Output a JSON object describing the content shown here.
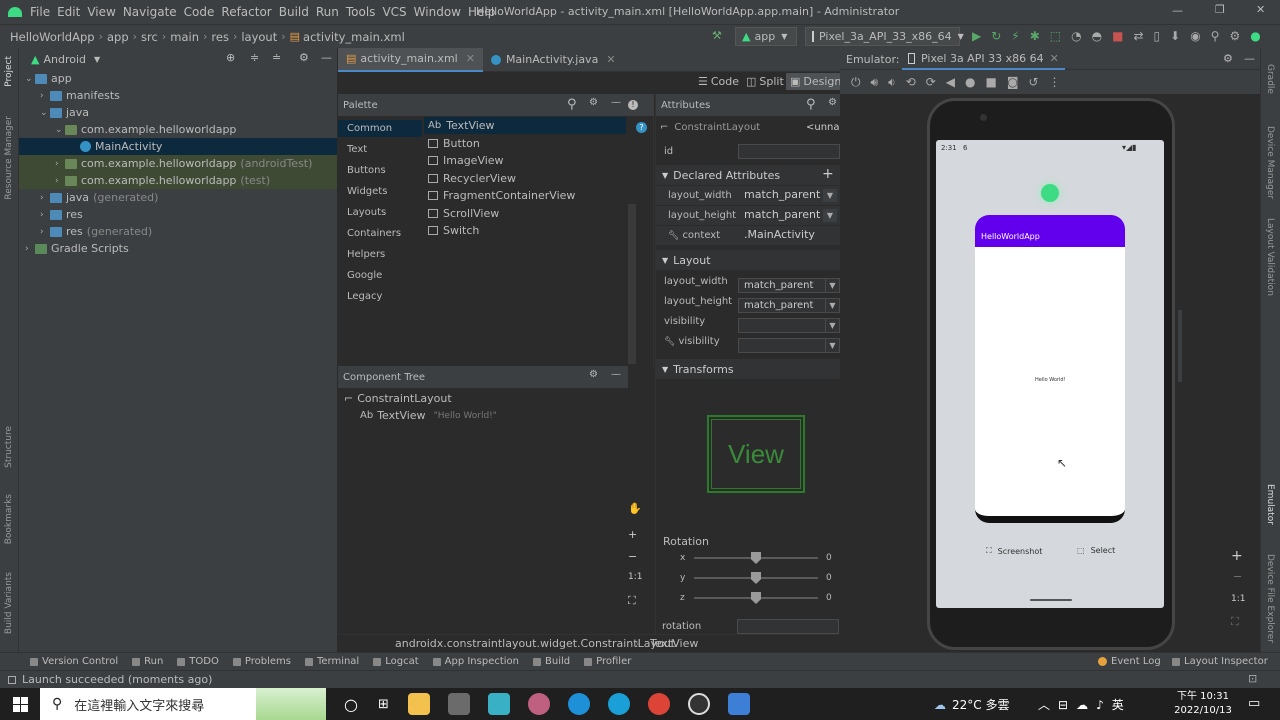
{
  "menubar": {
    "items": [
      "File",
      "Edit",
      "View",
      "Navigate",
      "Code",
      "Refactor",
      "Build",
      "Run",
      "Tools",
      "VCS",
      "Window",
      "Help"
    ],
    "title": "HelloWorldApp - activity_main.xml [HelloWorldApp.app.main] - Administrator",
    "run_config": "app",
    "device": "Pixel_3a_API_33_x86_64"
  },
  "breadcrumb": [
    "HelloWorldApp",
    "app",
    "src",
    "main",
    "res",
    "layout",
    "activity_main.xml"
  ],
  "project": {
    "view": "Android",
    "tree": [
      {
        "label": "app",
        "level": 0,
        "kind": "module"
      },
      {
        "label": "manifests",
        "level": 1,
        "kind": "folder"
      },
      {
        "label": "java",
        "level": 1,
        "kind": "folder"
      },
      {
        "label": "com.example.helloworldapp",
        "level": 2,
        "kind": "package"
      },
      {
        "label": "MainActivity",
        "level": 3,
        "kind": "class",
        "selected": true
      },
      {
        "label": "com.example.helloworldapp",
        "suffix": "(androidTest)",
        "level": 2,
        "kind": "package"
      },
      {
        "label": "com.example.helloworldapp",
        "suffix": "(test)",
        "level": 2,
        "kind": "package"
      },
      {
        "label": "java",
        "suffix": "(generated)",
        "level": 1,
        "kind": "folder"
      },
      {
        "label": "res",
        "level": 1,
        "kind": "folder"
      },
      {
        "label": "res",
        "suffix": "(generated)",
        "level": 1,
        "kind": "folder"
      },
      {
        "label": "Gradle Scripts",
        "level": 0,
        "kind": "gradle"
      }
    ]
  },
  "left_strip": [
    "Project",
    "Resource Manager",
    "Structure",
    "Bookmarks",
    "Build Variants"
  ],
  "editor": {
    "tabs": [
      "activity_main.xml",
      "MainActivity.java"
    ],
    "modes": [
      "Code",
      "Split",
      "Design"
    ]
  },
  "palette": {
    "title": "Palette",
    "categories": [
      "Common",
      "Text",
      "Buttons",
      "Widgets",
      "Layouts",
      "Containers",
      "Helpers",
      "Google",
      "Legacy"
    ],
    "items": [
      "TextView",
      "Button",
      "ImageView",
      "RecyclerView",
      "FragmentContainerView",
      "ScrollView",
      "Switch"
    ]
  },
  "component_tree": {
    "title": "Component Tree",
    "root": "ConstraintLayout",
    "child": "TextView",
    "child_text": "\"Hello World!\""
  },
  "attributes": {
    "title": "Attributes",
    "component": "ConstraintLayout",
    "component_id": "<unnan",
    "id_label": "id",
    "declared_header": "Declared Attributes",
    "declared": [
      {
        "name": "layout_width",
        "value": "match_parent"
      },
      {
        "name": "layout_height",
        "value": "match_parent"
      },
      {
        "name": "context",
        "value": ".MainActivity"
      }
    ],
    "layout_header": "Layout",
    "layout": [
      {
        "name": "layout_width",
        "value": "match_parent"
      },
      {
        "name": "layout_height",
        "value": "match_parent"
      },
      {
        "name": "visibility",
        "value": ""
      },
      {
        "name": "visibility",
        "value": ""
      }
    ],
    "transforms_header": "Transforms",
    "view_preview": "View",
    "rotation_label": "Rotation",
    "rotation": [
      {
        "axis": "x",
        "value": "0"
      },
      {
        "axis": "y",
        "value": "0"
      },
      {
        "axis": "z",
        "value": "0"
      }
    ],
    "rotation_field": "rotation"
  },
  "path": [
    "androidx.constraintlayout.widget.ConstraintLayout",
    "TextView"
  ],
  "emulator": {
    "label": "Emulator:",
    "device_tab": "Pixel 3a API 33 x86 64",
    "status_time": "2:31",
    "status_icon": "6",
    "app_title": "HelloWorldApp",
    "hello_text": "Hello World!",
    "screenshot": "Screenshot",
    "select": "Select",
    "zoom_reset": "1:1"
  },
  "right_strip": [
    "Gradle",
    "Device Manager",
    "Layout Validation",
    "Emulator",
    "Device File Explorer"
  ],
  "toolwindows": [
    "Version Control",
    "Run",
    "TODO",
    "Problems",
    "Terminal",
    "Logcat",
    "App Inspection",
    "Build",
    "Profiler"
  ],
  "toolwindows_right": [
    "Event Log",
    "Layout Inspector"
  ],
  "status": "Launch succeeded (moments ago)",
  "taskbar": {
    "search_placeholder": "在這裡輸入文字來搜尋",
    "weather": "22°C 多雲",
    "ime": "英",
    "time": "下午 10:31",
    "date": "2022/10/13"
  }
}
